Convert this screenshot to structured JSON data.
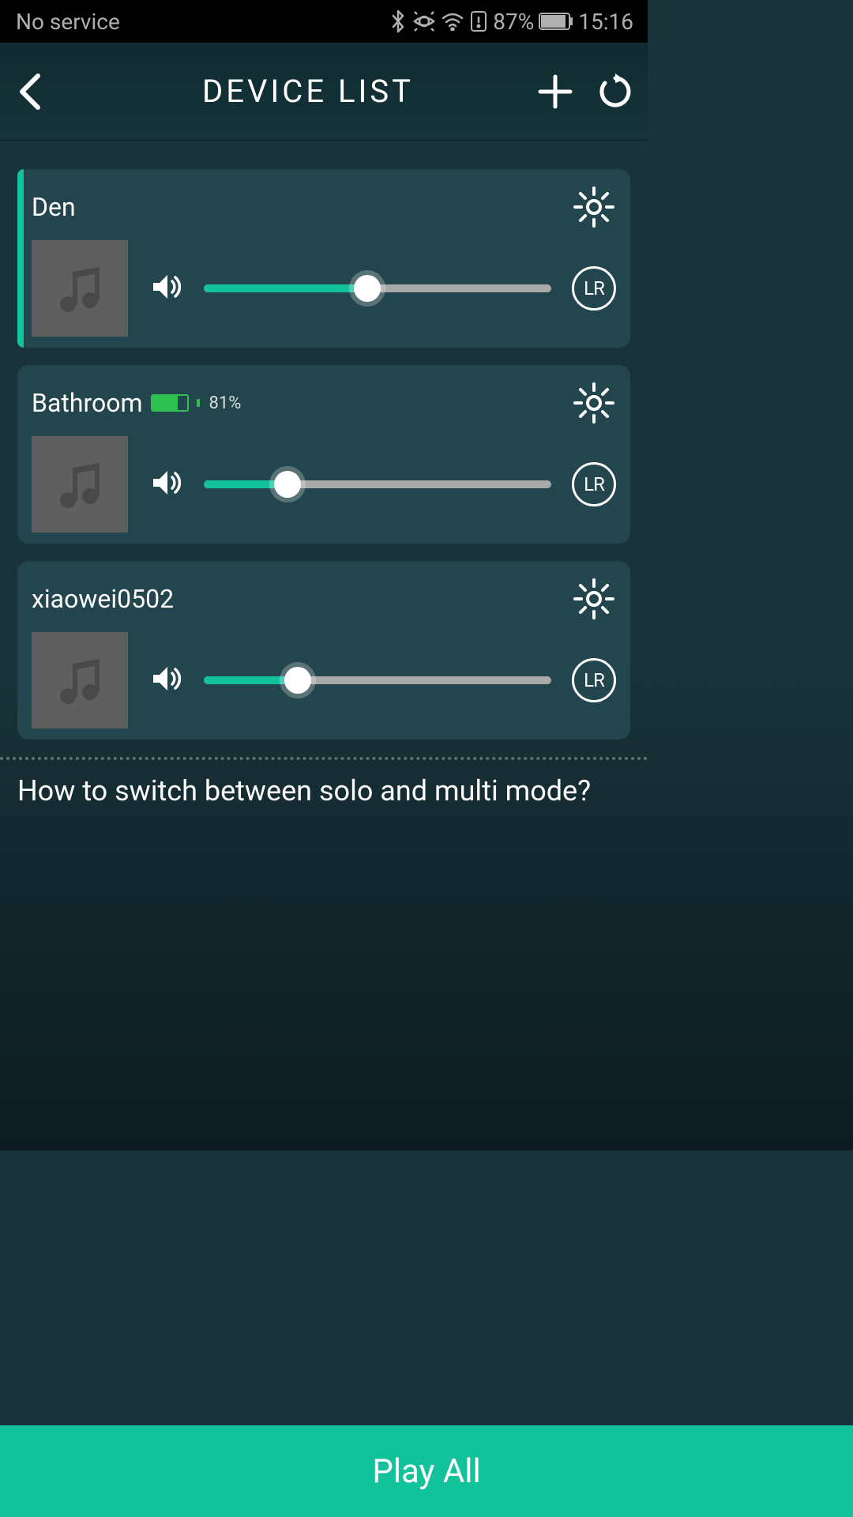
{
  "status_bar": {
    "carrier": "No service",
    "battery_pct": "87%",
    "time": "15:16"
  },
  "header": {
    "title": "DEVICE LIST"
  },
  "devices": [
    {
      "name": "Den",
      "active": true,
      "has_battery": false,
      "battery_pct": "",
      "volume_pct": 47,
      "lr": "LR"
    },
    {
      "name": "Bathroom",
      "active": false,
      "has_battery": true,
      "battery_pct": "81%",
      "volume_pct": 24,
      "lr": "LR"
    },
    {
      "name": "xiaowei0502",
      "active": false,
      "has_battery": false,
      "battery_pct": "",
      "volume_pct": 27,
      "lr": "LR"
    }
  ],
  "help_text": "How to switch between solo and multi mode?",
  "play_all_label": "Play All",
  "colors": {
    "accent": "#12c29a",
    "card_bg": "#23454d",
    "bg_top": "#18343a"
  }
}
